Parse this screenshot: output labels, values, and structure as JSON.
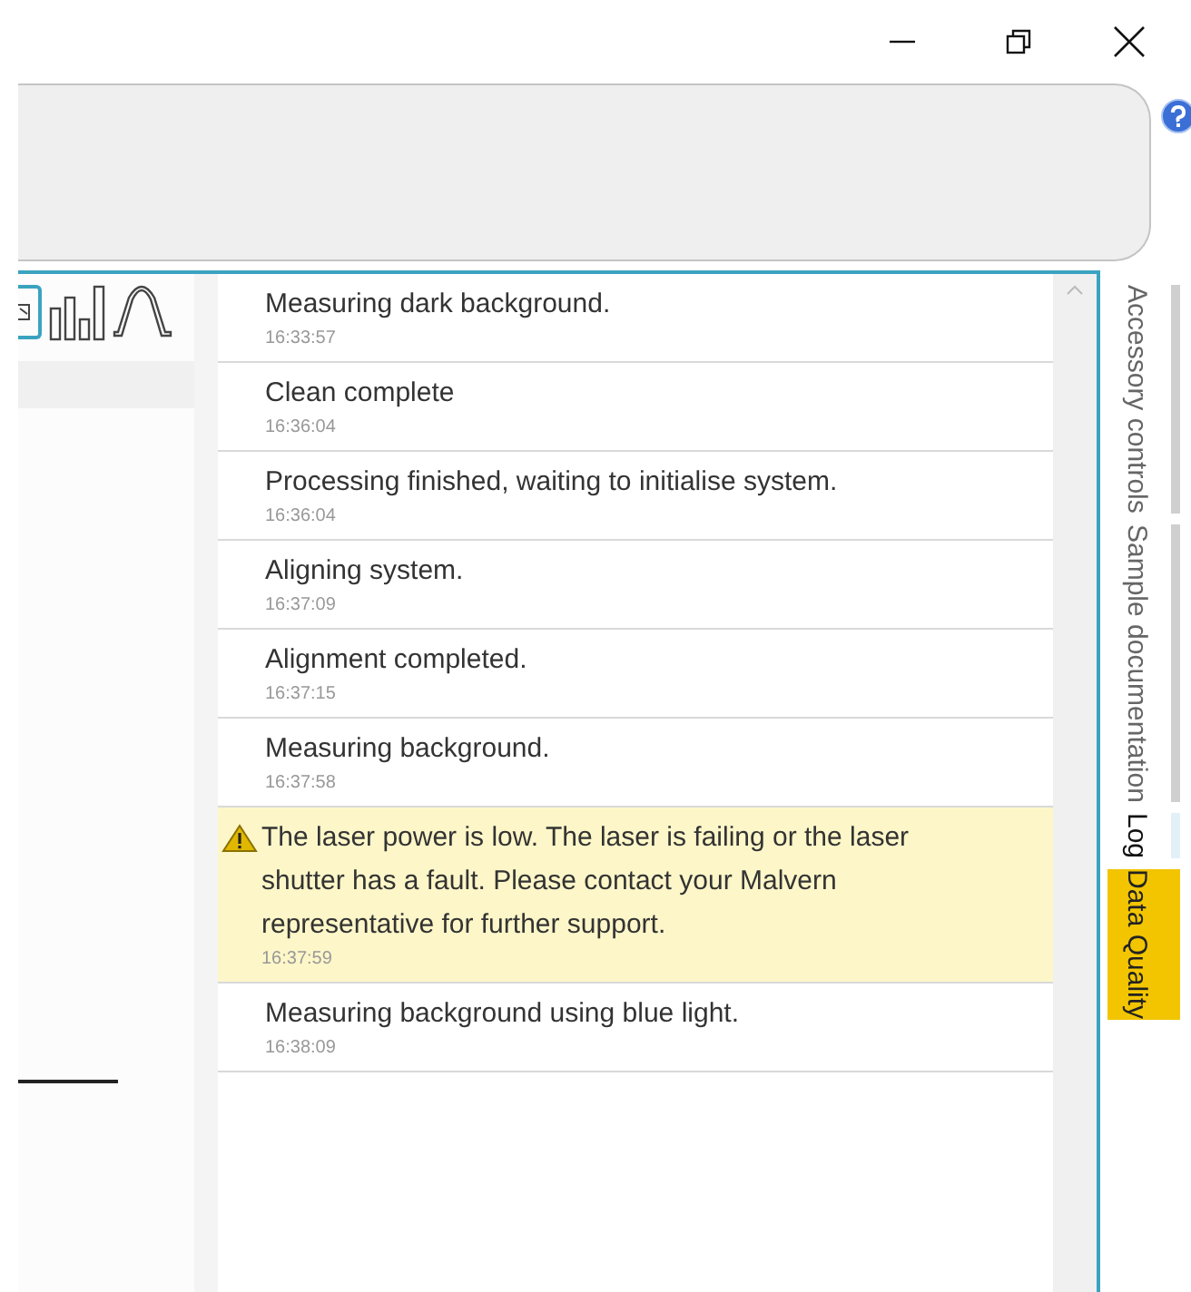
{
  "log": [
    {
      "kind": "info",
      "message": "Measuring dark background.",
      "time": "16:33:57"
    },
    {
      "kind": "info",
      "message": "Clean complete",
      "time": "16:36:04"
    },
    {
      "kind": "info",
      "message": "Processing finished, waiting to initialise system.",
      "time": "16:36:04"
    },
    {
      "kind": "info",
      "message": "Aligning system.",
      "time": "16:37:09"
    },
    {
      "kind": "info",
      "message": "Alignment completed.",
      "time": "16:37:15"
    },
    {
      "kind": "info",
      "message": "Measuring background.",
      "time": "16:37:58"
    },
    {
      "kind": "warning",
      "message": "The laser power is low. The laser is failing or the laser shutter has a fault. Please contact your Malvern representative for further support.",
      "time": "16:37:59"
    },
    {
      "kind": "info",
      "message": "Measuring background using blue light.",
      "time": "16:38:09"
    }
  ],
  "side_tabs": [
    {
      "label": "Accessory controls",
      "selected": false,
      "alert": false
    },
    {
      "label": "Sample documentation",
      "selected": false,
      "alert": false
    },
    {
      "label": "Log",
      "selected": true,
      "alert": false
    },
    {
      "label": "Data Quality",
      "selected": false,
      "alert": true
    }
  ]
}
